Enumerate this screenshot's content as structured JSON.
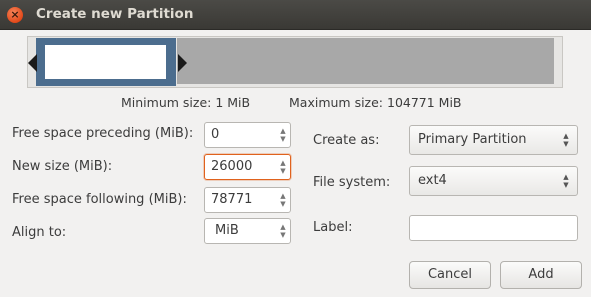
{
  "window": {
    "title": "Create new Partition"
  },
  "size_info": {
    "minimum": "Minimum size: 1 MiB",
    "maximum": "Maximum size: 104771 MiB"
  },
  "fields": {
    "free_preceding": {
      "label": "Free space preceding (MiB):",
      "value": "0"
    },
    "new_size": {
      "label": "New size (MiB):",
      "value": "26000"
    },
    "free_following": {
      "label": "Free space following (MiB):",
      "value": "78771"
    },
    "align_to": {
      "label": "Align to:",
      "value": "MiB"
    }
  },
  "right_fields": {
    "create_as": {
      "label": "Create as:",
      "value": "Primary Partition"
    },
    "file_system": {
      "label": "File system:",
      "value": "ext4"
    },
    "label": {
      "label": "Label:",
      "value": ""
    }
  },
  "buttons": {
    "cancel": "Cancel",
    "add": "Add"
  },
  "colors": {
    "partition_used": "#4c6d8e",
    "free_space": "#a8a8a8",
    "focus": "#e0621d"
  }
}
